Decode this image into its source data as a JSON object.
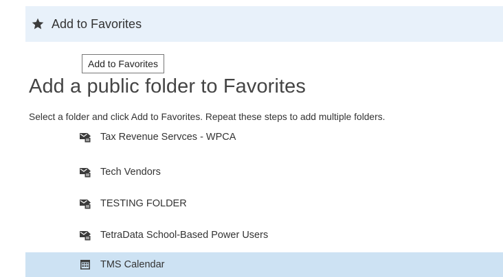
{
  "toolbar": {
    "icon": "star-icon",
    "label": "Add to Favorites",
    "background": "#e8f1fa"
  },
  "tooltip": {
    "text": "Add to Favorites"
  },
  "dialog": {
    "heading": "Add a public folder to Favorites",
    "instructions": "Select a folder and click Add to Favorites. Repeat these steps to add multiple folders."
  },
  "folders": [
    {
      "name": "Tax Revenue Servces - WPCA",
      "icon": "mail-folder-icon",
      "selected": false
    },
    {
      "name": "Tech Vendors",
      "icon": "mail-folder-icon",
      "selected": false
    },
    {
      "name": "TESTING FOLDER",
      "icon": "mail-folder-icon",
      "selected": false
    },
    {
      "name": "TetraData School-Based Power Users",
      "icon": "mail-folder-icon",
      "selected": false
    },
    {
      "name": "TMS Calendar",
      "icon": "calendar-folder-icon",
      "selected": true
    }
  ],
  "colors": {
    "selected_row": "#cde2f3",
    "icon": "#3c3c3c"
  }
}
